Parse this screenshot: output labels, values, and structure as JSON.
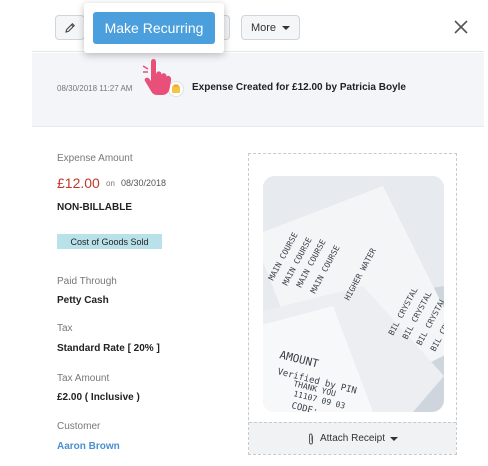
{
  "toolbar": {
    "edit_icon": "pencil-icon",
    "more_label": "More",
    "close_icon": "close-icon"
  },
  "popup": {
    "make_recurring_label": "Make Recurring"
  },
  "activity": {
    "timestamp": "08/30/2018 11:27 AM",
    "message": "Expense Created for £12.00 by Patricia Boyle"
  },
  "details": {
    "expense_amount_label": "Expense Amount",
    "expense_amount": "£12.00",
    "on_text": "on",
    "expense_date": "08/30/2018",
    "billable_status": "NON-BILLABLE",
    "account_badge": "Cost of Goods Sold",
    "paid_through_label": "Paid Through",
    "paid_through": "Petty Cash",
    "tax_label": "Tax",
    "tax": "Standard Rate [ 20% ]",
    "tax_amount_label": "Tax Amount",
    "tax_amount": "£2.00 ( Inclusive )",
    "customer_label": "Customer",
    "customer": "Aaron Brown"
  },
  "receipt": {
    "attach_label": "Attach Receipt",
    "image_text": [
      "AMOUNT",
      "Verified by PIN",
      "THANK YOU",
      "11107 09 03",
      "CODE:",
      "MAIN COURSE",
      "BIL CRYSTAL",
      "HIGHER WATER"
    ]
  },
  "colors": {
    "accent": "#4a9fdc",
    "amount_red": "#c0392b",
    "badge_bg": "#b9e1ea",
    "link_blue": "#4a8fd0",
    "hand_pink": "#e8507a"
  }
}
